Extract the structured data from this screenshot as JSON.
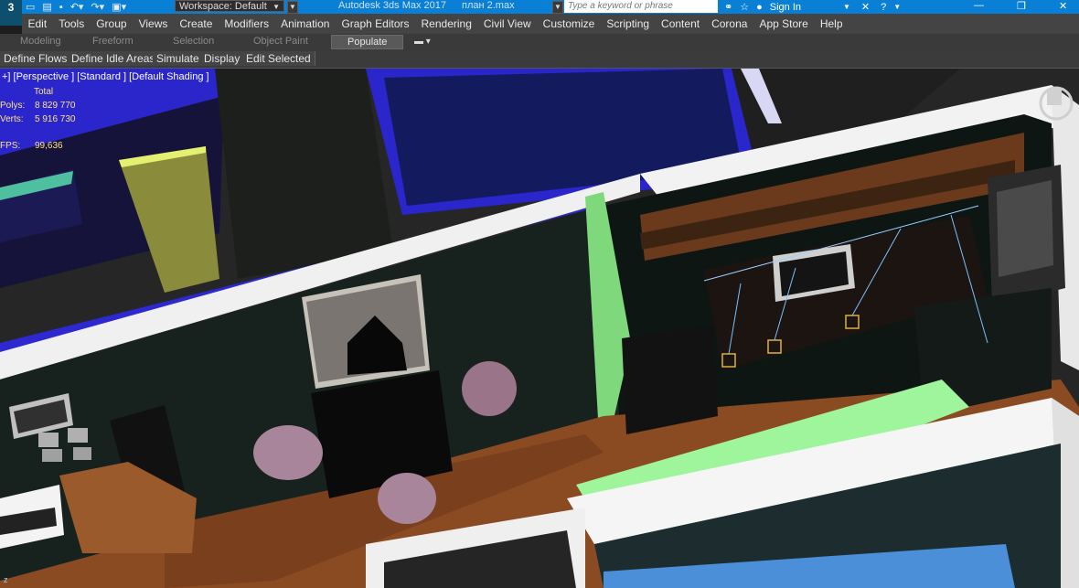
{
  "titlebar": {
    "app_logo": "3",
    "workspace_label": "Workspace: Default",
    "app_title": "Autodesk 3ds Max 2017",
    "file_name": "план 2.max",
    "search_placeholder": "Type a keyword or phrase",
    "sign_in": "Sign In",
    "quick_access_icons": [
      "new-file-icon",
      "open-file-icon",
      "save-icon",
      "undo-icon",
      "redo-icon",
      "project-icon"
    ],
    "right_icons": [
      "binoculars-icon",
      "star-icon",
      "user-icon",
      "close-x-icon",
      "help-icon"
    ],
    "window_controls": [
      "minimize-icon",
      "restore-icon",
      "close-icon"
    ]
  },
  "menubar": {
    "items": [
      "Edit",
      "Tools",
      "Group",
      "Views",
      "Create",
      "Modifiers",
      "Animation",
      "Graph Editors",
      "Rendering",
      "Civil View",
      "Customize",
      "Scripting",
      "Content",
      "Corona",
      "App Store",
      "Help"
    ]
  },
  "ribbon_tabs": {
    "items": [
      "Modeling",
      "Freeform",
      "Selection",
      "Object Paint",
      "Populate"
    ],
    "active": "Populate"
  },
  "populate_panel": {
    "buttons": [
      "Define Flows",
      "Define Idle Areas",
      "Simulate",
      "Display",
      "Edit Selected"
    ]
  },
  "viewport": {
    "label": "+] [Perspective ] [Standard ] [Default Shading ]",
    "stats_header": "Total",
    "polys_label": "Polys:",
    "polys_value": "8 829 770",
    "verts_label": "Verts:",
    "verts_value": "5 916 730",
    "fps_label": "FPS:",
    "fps_value": "99,636",
    "colors": {
      "wall_blue": "#2a26cc",
      "floor_wood": "#8a4a22",
      "wall_white": "#f0f0f0",
      "wall_dark": "#17221f",
      "highlight_green": "#9ef59c",
      "stat_yellow": "#ffe18a"
    }
  }
}
